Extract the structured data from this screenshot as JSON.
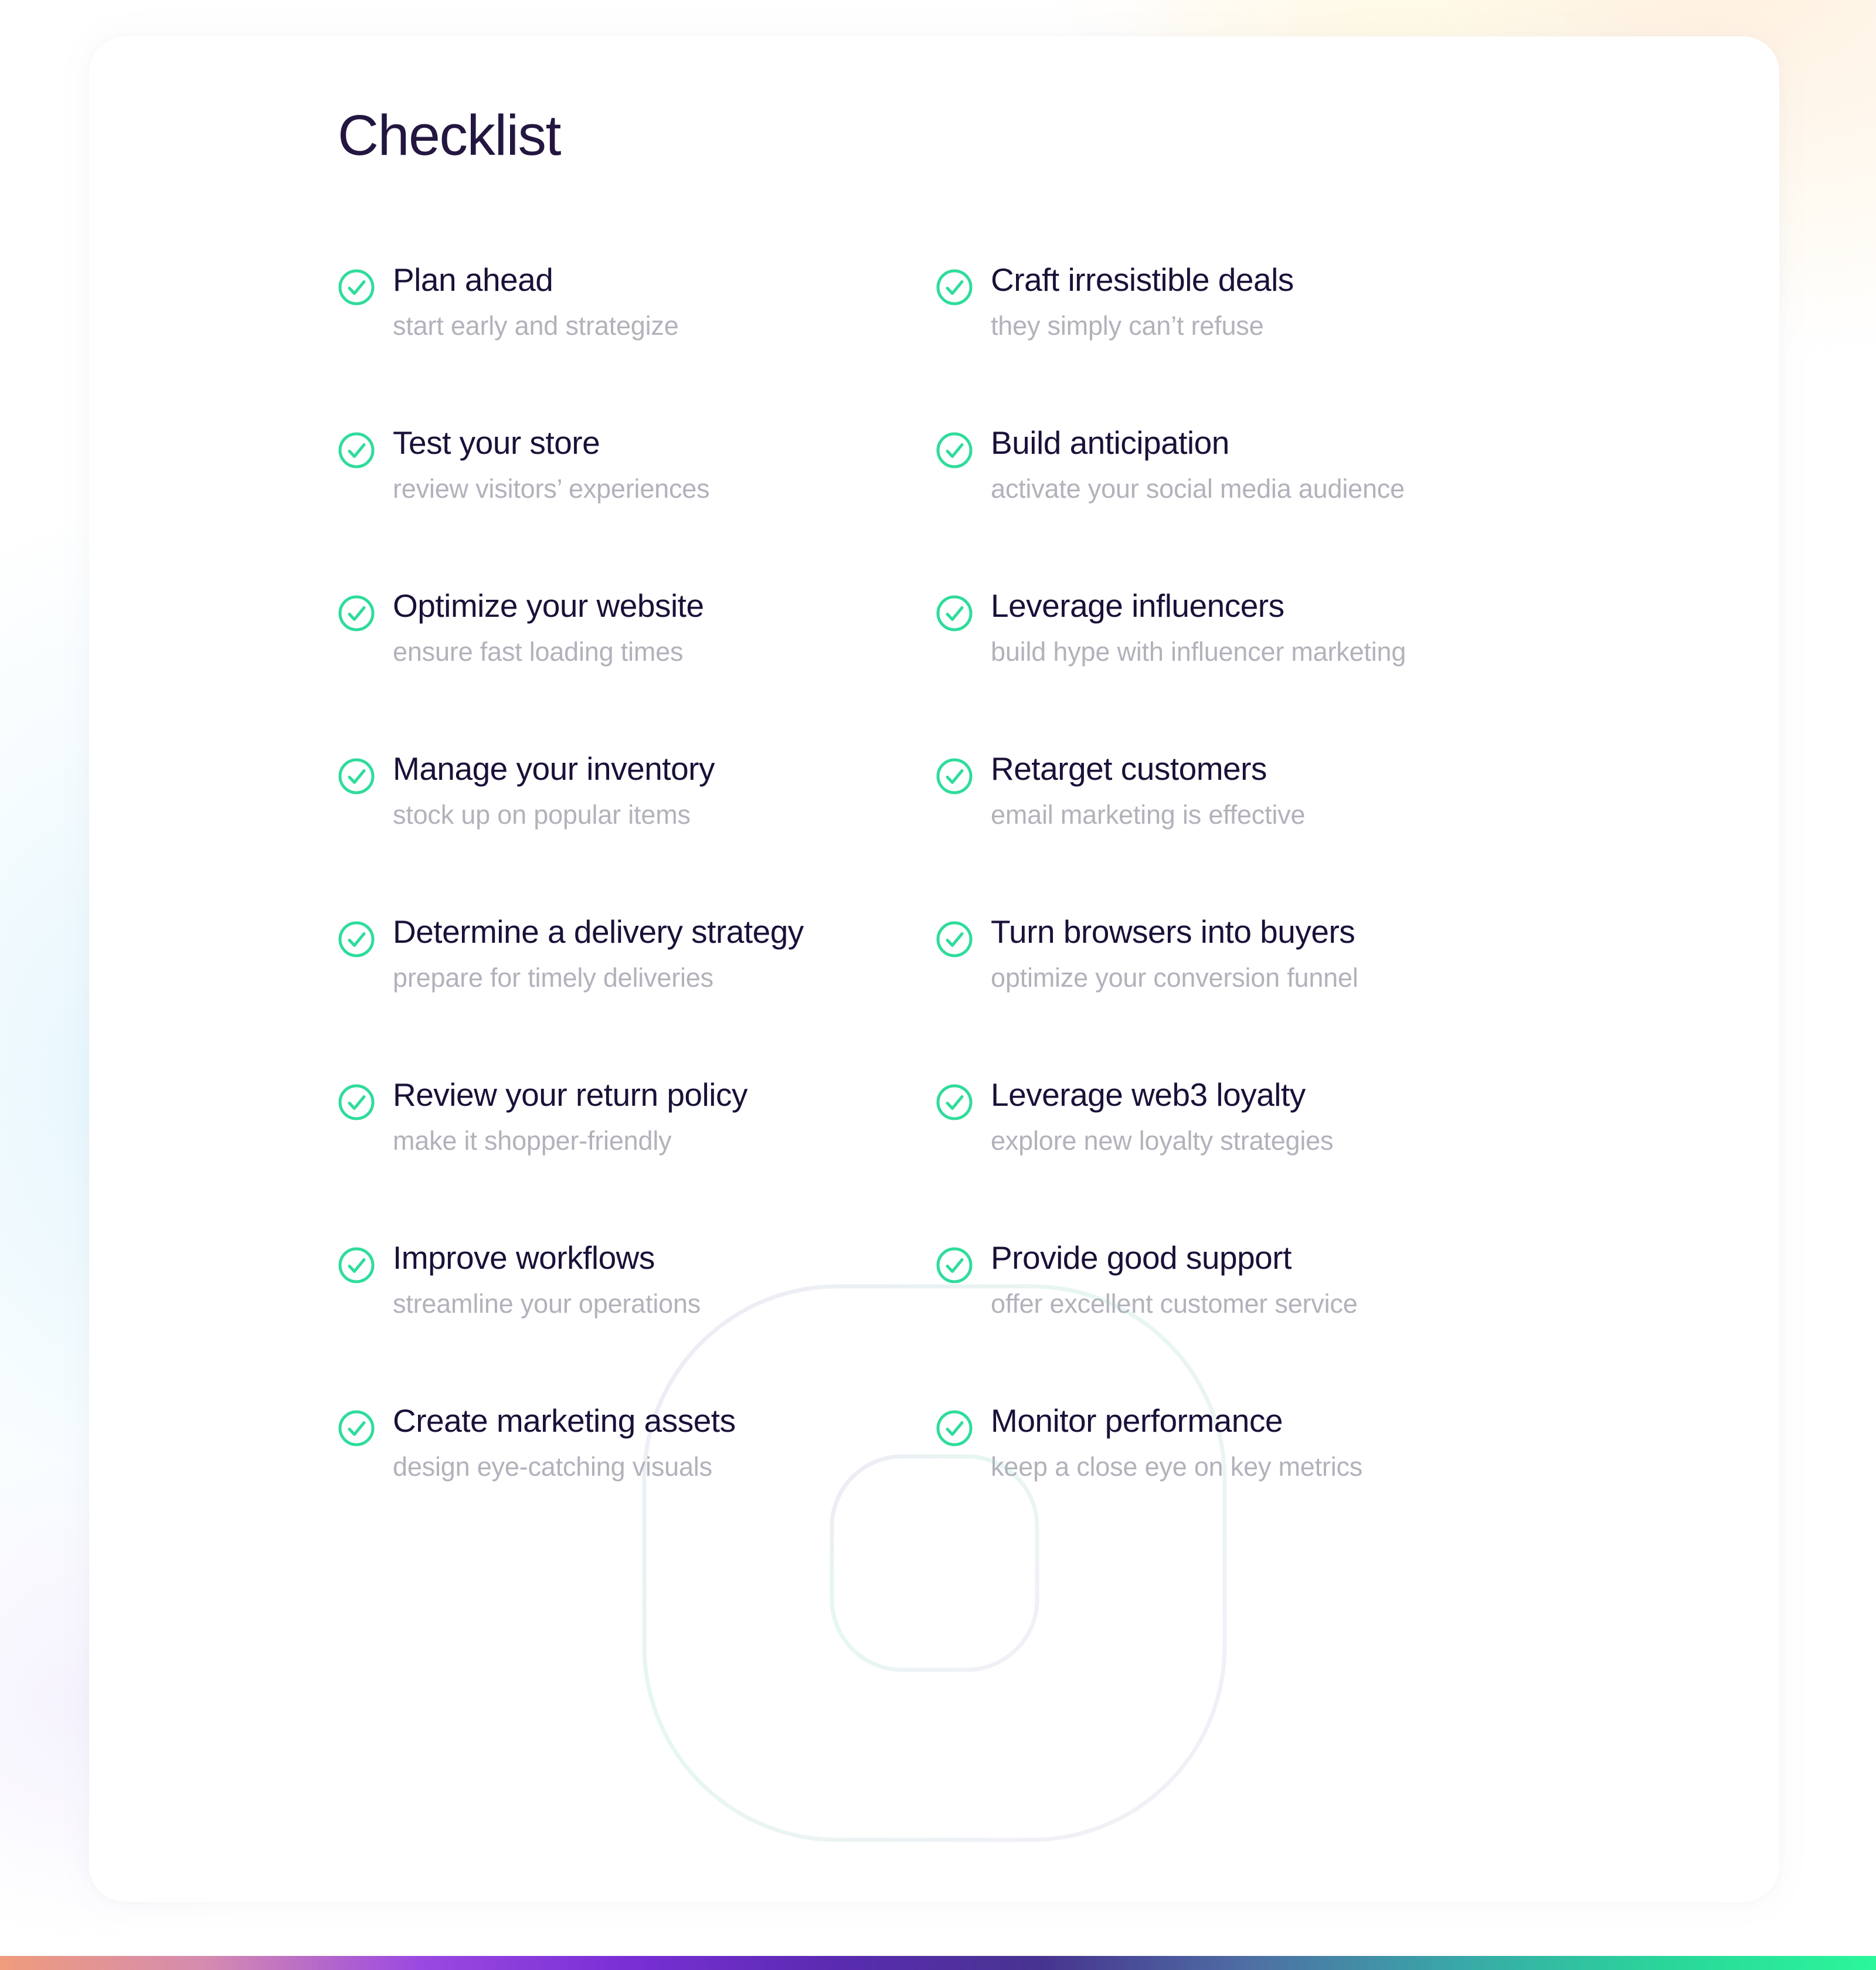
{
  "page": {
    "title": "Checklist",
    "brand_green": "#2fdc9b",
    "title_color": "#231640",
    "subtitle_color": "#b2b2bc",
    "check_icon_name": "check-circle-icon"
  },
  "gradient_bar": {
    "stops": [
      "#ef9c7c",
      "#d48bb0",
      "#9b4ae0",
      "#7a2fd6",
      "#5a2bb0",
      "#47348f",
      "#4e6fa4",
      "#39a8a8",
      "#2ad69a",
      "#2bf79a"
    ]
  },
  "checklist": {
    "columns": [
      {
        "items": [
          {
            "title": "Plan ahead",
            "subtitle": "start early and strategize",
            "checked": true
          },
          {
            "title": "Test your store",
            "subtitle": "review visitors’ experiences",
            "checked": true
          },
          {
            "title": "Optimize your website",
            "subtitle": "ensure fast loading times",
            "checked": true
          },
          {
            "title": "Manage your inventory",
            "subtitle": "stock up on popular items",
            "checked": true
          },
          {
            "title": "Determine a delivery strategy",
            "subtitle": "prepare for timely deliveries",
            "checked": true
          },
          {
            "title": "Review your return policy",
            "subtitle": "make it shopper-friendly",
            "checked": true
          },
          {
            "title": "Improve workflows",
            "subtitle": "streamline your operations",
            "checked": true
          },
          {
            "title": "Create marketing assets",
            "subtitle": "design eye-catching visuals",
            "checked": true
          }
        ]
      },
      {
        "items": [
          {
            "title": "Craft irresistible deals",
            "subtitle": "they simply can’t refuse",
            "checked": true
          },
          {
            "title": "Build anticipation",
            "subtitle": "activate your social media audience",
            "checked": true
          },
          {
            "title": "Leverage influencers",
            "subtitle": "build hype with influencer marketing",
            "checked": true
          },
          {
            "title": "Retarget customers",
            "subtitle": "email marketing is effective",
            "checked": true
          },
          {
            "title": "Turn browsers into buyers",
            "subtitle": "optimize your conversion funnel",
            "checked": true
          },
          {
            "title": "Leverage web3 loyalty",
            "subtitle": "explore new loyalty strategies",
            "checked": true
          },
          {
            "title": "Provide good support",
            "subtitle": "offer excellent customer service",
            "checked": true
          },
          {
            "title": "Monitor performance",
            "subtitle": "keep a close eye on key metrics",
            "checked": true
          }
        ]
      }
    ]
  }
}
